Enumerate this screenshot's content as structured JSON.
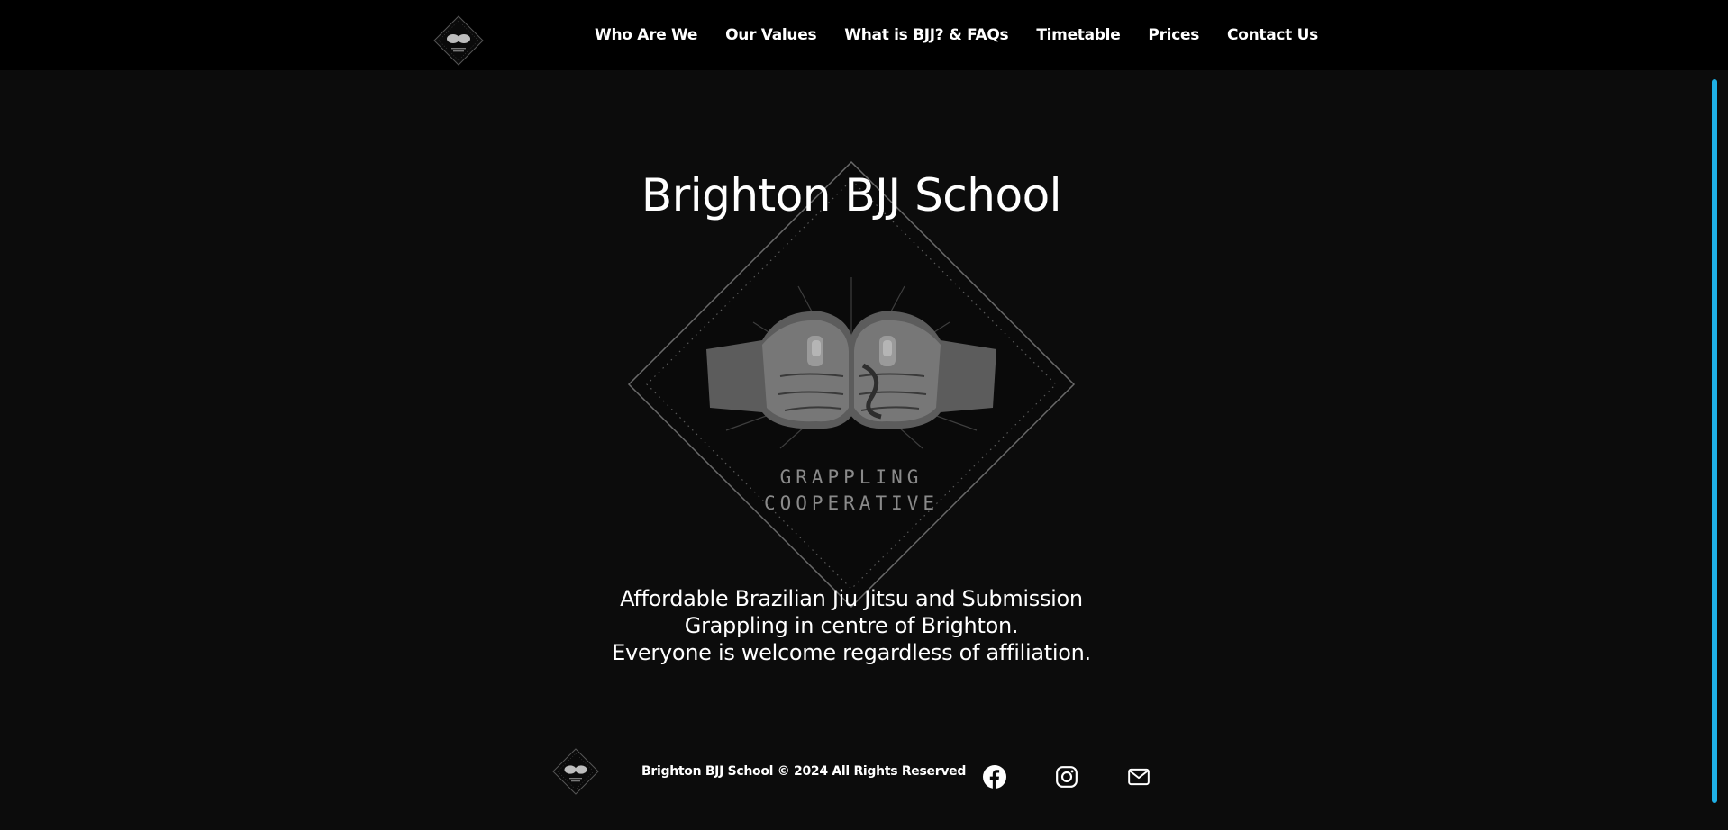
{
  "nav": {
    "logo_alt": "Brighton BJJ School logo",
    "links": [
      {
        "label": "Who Are We"
      },
      {
        "label": "Our Values"
      },
      {
        "label": "What is BJJ? & FAQs"
      },
      {
        "label": "Timetable"
      },
      {
        "label": "Prices"
      },
      {
        "label": "Contact Us"
      }
    ]
  },
  "hero": {
    "title": "Brighton BJJ School",
    "emblem_text_line1": "GRAPPLING",
    "emblem_text_line2": "COOPERATIVE",
    "subtitle_lines": [
      "Affordable Brazilian Jiu Jitsu and Submission",
      "Grappling in centre of Brighton.",
      "Everyone is welcome regardless of affiliation."
    ]
  },
  "footer": {
    "copyright": "Brighton BJJ School © 2024 All Rights Reserved",
    "icons": [
      "facebook-icon",
      "instagram-icon",
      "mail-icon"
    ]
  },
  "colors": {
    "background": "#0c0c0c",
    "nav_background": "#000000",
    "scrollbar_accent": "#1fb0e6",
    "text": "#ffffff"
  }
}
